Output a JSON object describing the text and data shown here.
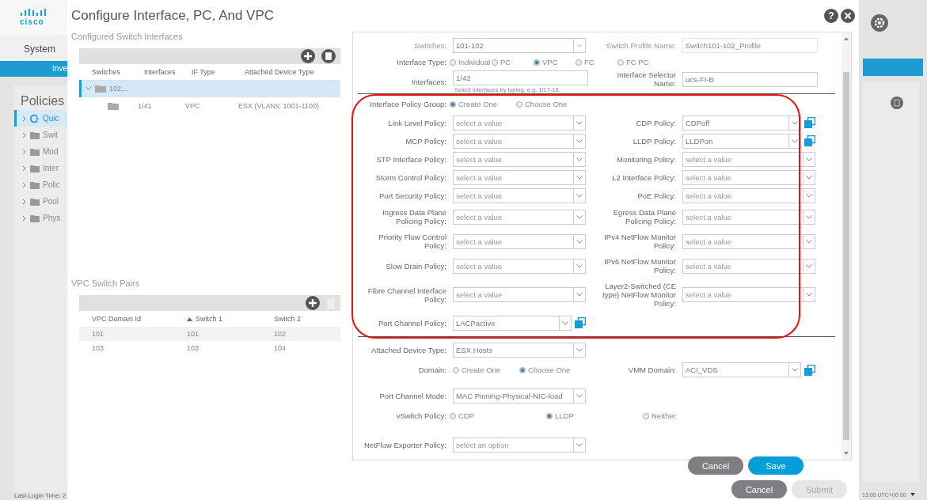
{
  "app": {
    "logo_text": "cisco",
    "nav_title": "System",
    "nav_tab": "Inve",
    "section_title": "Policies",
    "tree": [
      {
        "label": "Quic",
        "kind": "quickstart",
        "selected": true
      },
      {
        "label": "Swit",
        "kind": "folder",
        "selected": false
      },
      {
        "label": "Mod",
        "kind": "folder",
        "selected": false
      },
      {
        "label": "Inter",
        "kind": "folder",
        "selected": false
      },
      {
        "label": "Polic",
        "kind": "folder",
        "selected": false
      },
      {
        "label": "Pool",
        "kind": "folder",
        "selected": false
      },
      {
        "label": "Phys",
        "kind": "folder",
        "selected": false
      }
    ],
    "login_text": "Last Login Time: 2",
    "time_text": "13:06 UTC+00:00"
  },
  "dialog": {
    "title": "Configure Interface, PC, And VPC",
    "help_glyph": "?",
    "interfaces_section": {
      "title": "Configured Switch Interfaces",
      "delete_disabled": false,
      "columns": [
        "Switches",
        "Interfaces",
        "IF Type",
        "Attached Device Type"
      ],
      "rows": [
        {
          "switches": "102,...",
          "expanded": true,
          "selected": true,
          "children": [
            {
              "interfaces": "1/41",
              "if_type": "VPC",
              "attached": "ESX (VLANs: 1001-1100)"
            }
          ]
        }
      ]
    },
    "pairs_section": {
      "title": "VPC Switch Pairs",
      "delete_disabled": true,
      "columns": [
        {
          "label": "VPC Domain Id",
          "sorted": false
        },
        {
          "label": "Switch 1",
          "sorted": true
        },
        {
          "label": "Switch 2",
          "sorted": false
        }
      ],
      "rows": [
        {
          "cells": [
            "101",
            "101",
            "102"
          ],
          "selected": true
        },
        {
          "cells": [
            "103",
            "103",
            "104"
          ],
          "selected": false
        }
      ]
    },
    "form": {
      "switches": {
        "label": "Switches:",
        "value": "101-102"
      },
      "profile_name": {
        "label": "Switch Profile Name:",
        "value": "Switch101-102_Profile"
      },
      "interface_type": {
        "label": "Interface Type:",
        "options": [
          {
            "label": "Individual",
            "selected": false
          },
          {
            "label": "PC",
            "selected": false
          },
          {
            "label": "VPC",
            "selected": true
          },
          {
            "label": "FC",
            "selected": false
          },
          {
            "label": "FC PC",
            "selected": false
          }
        ]
      },
      "interfaces": {
        "label": "Interfaces:",
        "value": "1/42",
        "hint": "Select interfaces by typing, e.g. 1/17-18."
      },
      "selector_name": {
        "label": "Interface Selector Name:",
        "value": "ucs-FI-B"
      },
      "policy_highlighted": true,
      "policy_group": {
        "label": "Interface Policy Group:",
        "options": [
          {
            "label": "Create One",
            "selected": true
          },
          {
            "label": "Choose One",
            "selected": false
          }
        ]
      },
      "policy_rows": [
        {
          "left": {
            "label": "Link Level Policy:",
            "placeholder": "select a value",
            "link": false
          },
          "right": {
            "label": "CDP Policy:",
            "value": "CDPoff",
            "link": true
          }
        },
        {
          "left": {
            "label": "MCP Policy:",
            "placeholder": "select a value",
            "link": false
          },
          "right": {
            "label": "LLDP Policy:",
            "value": "LLDPon",
            "link": true
          }
        },
        {
          "left": {
            "label": "STP Interface Policy:",
            "placeholder": "select a value",
            "link": false
          },
          "right": {
            "label": "Monitoring Policy:",
            "placeholder": "select a value",
            "link": false
          }
        },
        {
          "left": {
            "label": "Storm Control Policy:",
            "placeholder": "select a value",
            "link": false
          },
          "right": {
            "label": "L2 Interface Policy:",
            "placeholder": "select a value",
            "link": false
          }
        },
        {
          "left": {
            "label": "Port Security Policy:",
            "placeholder": "select a value",
            "link": false
          },
          "right": {
            "label": "PoE Policy:",
            "placeholder": "select a value",
            "link": false
          }
        },
        {
          "left": {
            "label": "Ingress Data Plane Policing Policy:",
            "placeholder": "select a value",
            "link": false
          },
          "right": {
            "label": "Egress Data Plane Policing Policy:",
            "placeholder": "select a value",
            "link": false
          }
        },
        {
          "left": {
            "label": "Priority Flow Control Policy:",
            "placeholder": "select a value",
            "link": false
          },
          "right": {
            "label": "IPv4 NetFlow Monitor Policy:",
            "placeholder": "select a value",
            "link": false
          }
        },
        {
          "left": {
            "label": "Slow Drain Policy:",
            "placeholder": "select a value",
            "link": false
          },
          "right": {
            "label": "IPv6 NetFlow Monitor Policy:",
            "placeholder": "select a value",
            "link": false
          }
        },
        {
          "left": {
            "label": "Fibre Channel Interface Policy:",
            "placeholder": "select a value",
            "link": false
          },
          "right": {
            "label": "Layer2-Switched (CE type) NetFlow Monitor Policy:",
            "placeholder": "select a value",
            "link": false
          }
        },
        {
          "left": {
            "label": "Port Channel Policy:",
            "value": "LACPactive",
            "link": true
          }
        }
      ],
      "attached_device": {
        "label": "Attached Device Type:",
        "value": "ESX Hosts"
      },
      "domain": {
        "label": "Domain:",
        "options": [
          {
            "label": "Create One",
            "selected": false
          },
          {
            "label": "Choose One",
            "selected": true
          }
        ]
      },
      "vmm_domain": {
        "label": "VMM Domain:",
        "value": "ACI_VDS",
        "link": true
      },
      "port_channel_mode": {
        "label": "Port Channel Mode:",
        "value": "MAC Pinning-Physical-NIC-load"
      },
      "vswitch_policy": {
        "label": "vSwitch Policy:",
        "options": [
          {
            "label": "CDP",
            "selected": false
          },
          {
            "label": "LLDP",
            "selected": true
          },
          {
            "label": "Neither",
            "selected": false
          }
        ]
      },
      "netflow_exporter": {
        "label": "NetFlow Exporter Policy:",
        "placeholder": "select an option"
      },
      "buttons": [
        {
          "label": "Cancel",
          "kind": "secondary"
        },
        {
          "label": "Save",
          "kind": "primary"
        }
      ]
    },
    "footer_buttons": [
      {
        "label": "Cancel",
        "kind": "secondary"
      },
      {
        "label": "Submit",
        "kind": "disabled"
      }
    ]
  }
}
